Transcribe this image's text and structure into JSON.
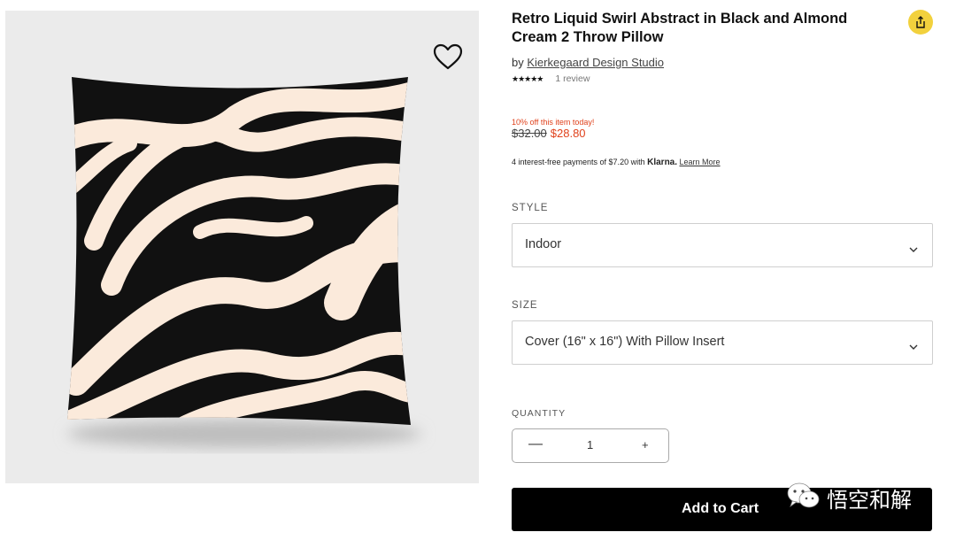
{
  "product": {
    "title": "Retro Liquid Swirl Abstract in Black and Almond Cream 2 Throw Pillow",
    "by_prefix": "by",
    "artist": "Kierkegaard Design Studio",
    "rating_stars": "★★★★★",
    "rating_value": 5,
    "review_count": "1 review"
  },
  "pricing": {
    "promo": "10% off this item today!",
    "old_price": "$32.00",
    "new_price": "$28.80",
    "klarna_text": "4 interest-free payments of $7.20 with",
    "klarna_brand": "Klarna.",
    "learn_more": "Learn More"
  },
  "style": {
    "label": "STYLE",
    "value": "Indoor"
  },
  "size": {
    "label": "SIZE",
    "value": "Cover (16\" x 16\") With Pillow Insert"
  },
  "quantity": {
    "label": "QUANTITY",
    "minus": "—",
    "value": "1",
    "plus": "+"
  },
  "cart": {
    "label": "Add to Cart"
  },
  "watermark": {
    "text": "悟空和解"
  },
  "colors": {
    "accent_yellow": "#f2d13d",
    "sale_red": "#e0421c",
    "pillow_black": "#111111",
    "pillow_cream": "#fbeadb",
    "button_black": "#000000"
  },
  "icons": {
    "favorite": "heart-outline-icon",
    "share": "share-icon",
    "select": "chevron-down-icon",
    "watermark": "wechat-icon"
  }
}
